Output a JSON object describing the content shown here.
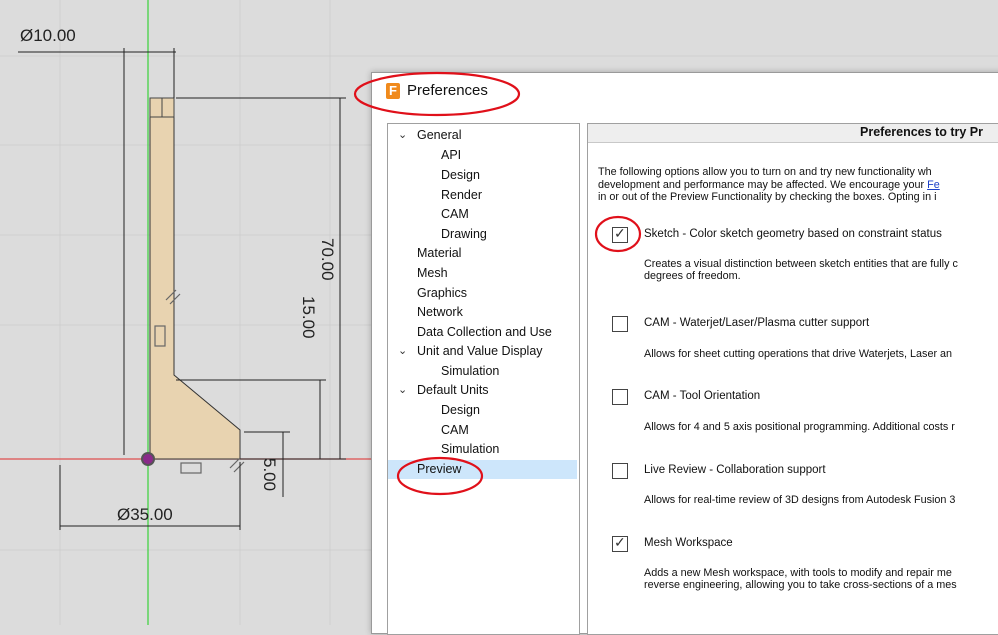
{
  "cad": {
    "dims": {
      "top_diameter": "Ø10.00",
      "height": "70.00",
      "mid_height": "15.00",
      "base_height": "5.00",
      "base_diameter": "Ø35.00"
    }
  },
  "dialog": {
    "title": "Preferences",
    "icon_letter": "F",
    "tree": {
      "items": [
        {
          "label": "General",
          "expanded": true
        },
        {
          "label": "API"
        },
        {
          "label": "Design"
        },
        {
          "label": "Render"
        },
        {
          "label": "CAM"
        },
        {
          "label": "Drawing"
        },
        {
          "label": "Material"
        },
        {
          "label": "Mesh"
        },
        {
          "label": "Graphics"
        },
        {
          "label": "Network"
        },
        {
          "label": "Data Collection and Use"
        },
        {
          "label": "Unit and Value Display",
          "expanded": true
        },
        {
          "label": "Simulation"
        },
        {
          "label": "Default Units",
          "expanded": true
        },
        {
          "label": "Design"
        },
        {
          "label": "CAM"
        },
        {
          "label": "Simulation"
        },
        {
          "label": "Preview",
          "selected": true
        }
      ]
    },
    "panel": {
      "header": "Preferences to try Pr",
      "intro_1": "The following options allow you to turn on and try new functionality wh",
      "intro_2a": "development and performance may be affected. We encourage your ",
      "intro_2_link": "Fe",
      "intro_3": "in or out of the Preview Functionality by checking the boxes. Opting in i",
      "options": [
        {
          "label": "Sketch - Color sketch geometry based on constraint status",
          "checked": true,
          "desc_1": "Creates a visual distinction between sketch entities that are fully c",
          "desc_2": "degrees of freedom."
        },
        {
          "label": "CAM - Waterjet/Laser/Plasma cutter support",
          "checked": false,
          "desc_1": "Allows for sheet cutting operations that drive Waterjets, Laser an",
          "desc_2": ""
        },
        {
          "label": "CAM - Tool Orientation",
          "checked": false,
          "desc_1": "Allows for 4 and 5 axis positional programming. Additional costs r",
          "desc_2": ""
        },
        {
          "label": "Live Review - Collaboration support",
          "checked": false,
          "desc_1": "Allows for real-time review of 3D designs from Autodesk Fusion 3",
          "desc_2": ""
        },
        {
          "label": "Mesh Workspace",
          "checked": true,
          "desc_1": "Adds a new Mesh workspace, with tools to modify and repair me",
          "desc_2": "reverse engineering, allowing you to take cross-sections of a mes"
        }
      ]
    }
  },
  "colors": {
    "annotation": "#e0101a",
    "part_fill": "#e8d3b0",
    "axis_green": "#3ad13a",
    "axis_red": "#e05050",
    "selection": "#cde6fb"
  }
}
